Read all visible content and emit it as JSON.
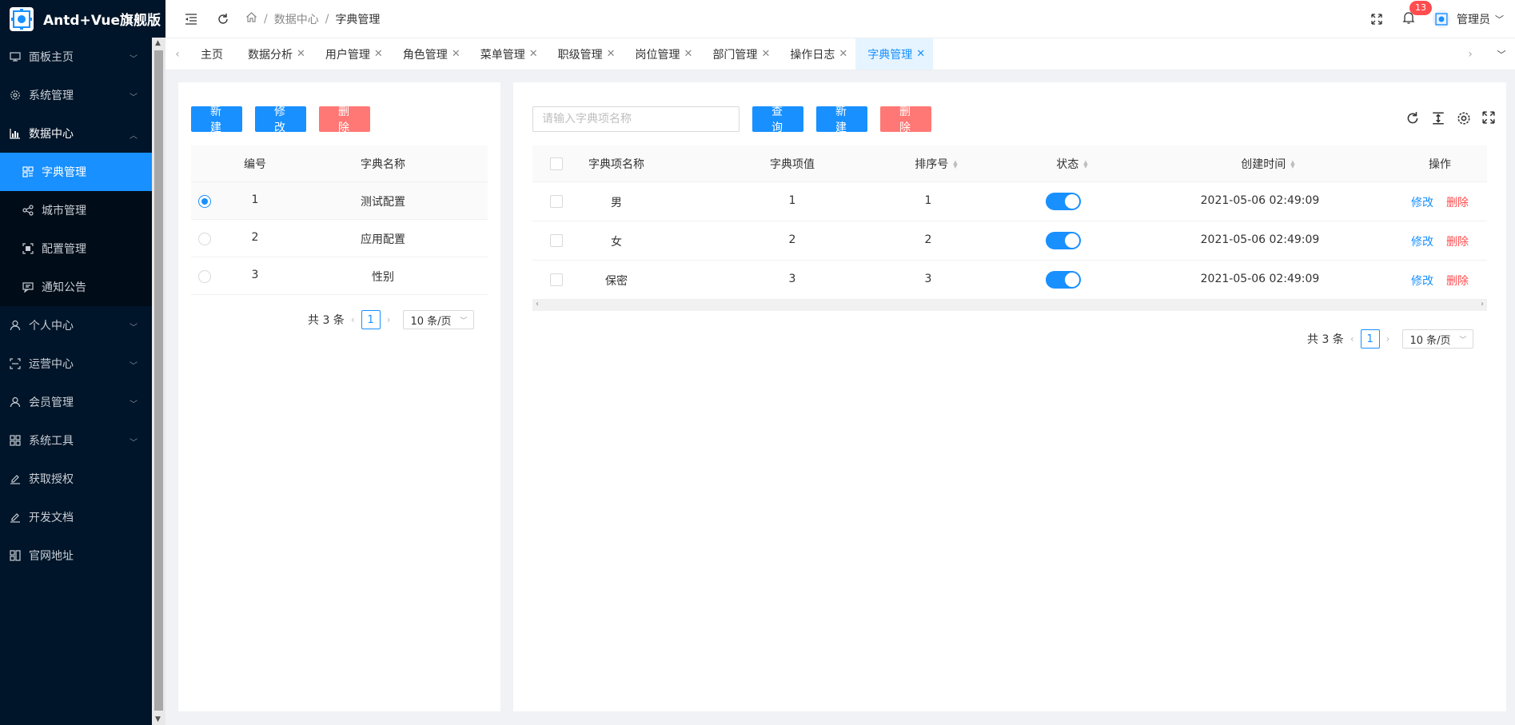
{
  "app": {
    "title": "Antd+Vue旗舰版"
  },
  "sidebar": {
    "items": [
      {
        "label": "面板主页",
        "icon": "monitor-icon"
      },
      {
        "label": "系统管理",
        "icon": "gear-icon"
      },
      {
        "label": "数据中心",
        "icon": "chart-icon",
        "open": true,
        "children": [
          {
            "label": "字典管理",
            "icon": "dictionary-icon",
            "active": true
          },
          {
            "label": "城市管理",
            "icon": "share-icon"
          },
          {
            "label": "配置管理",
            "icon": "scan-icon"
          },
          {
            "label": "通知公告",
            "icon": "message-icon"
          }
        ]
      },
      {
        "label": "个人中心",
        "icon": "user-icon"
      },
      {
        "label": "运营中心",
        "icon": "scan-icon"
      },
      {
        "label": "会员管理",
        "icon": "user-icon"
      },
      {
        "label": "系统工具",
        "icon": "appstore-icon"
      },
      {
        "label": "获取授权",
        "icon": "edit-icon"
      },
      {
        "label": "开发文档",
        "icon": "edit-icon"
      },
      {
        "label": "官网地址",
        "icon": "appstore-icon"
      }
    ]
  },
  "header": {
    "breadcrumb": [
      "数据中心",
      "字典管理"
    ],
    "notification_count": "13",
    "user_name": "管理员"
  },
  "tabs": [
    {
      "label": "主页",
      "closable": false
    },
    {
      "label": "数据分析",
      "closable": true
    },
    {
      "label": "用户管理",
      "closable": true
    },
    {
      "label": "角色管理",
      "closable": true
    },
    {
      "label": "菜单管理",
      "closable": true
    },
    {
      "label": "职级管理",
      "closable": true
    },
    {
      "label": "岗位管理",
      "closable": true
    },
    {
      "label": "部门管理",
      "closable": true
    },
    {
      "label": "操作日志",
      "closable": true
    },
    {
      "label": "字典管理",
      "closable": true,
      "active": true
    }
  ],
  "left_panel": {
    "buttons": {
      "new": "新 建",
      "edit": "修 改",
      "delete": "删 除"
    },
    "columns": [
      "编号",
      "字典名称"
    ],
    "rows": [
      {
        "id": "1",
        "name": "测试配置",
        "selected": true
      },
      {
        "id": "2",
        "name": "应用配置",
        "selected": false
      },
      {
        "id": "3",
        "name": "性别",
        "selected": false
      }
    ],
    "pagination": {
      "total": "共 3 条",
      "page": "1",
      "page_size": "10 条/页"
    }
  },
  "right_panel": {
    "search_placeholder": "请输入字典项名称",
    "buttons": {
      "query": "查 询",
      "new": "新 建",
      "delete": "删 除"
    },
    "columns": [
      "字典项名称",
      "字典项值",
      "排序号",
      "状态",
      "创建时间",
      "操作"
    ],
    "rows": [
      {
        "name": "男",
        "value": "1",
        "sort": "1",
        "status": true,
        "created": "2021-05-06 02:49:09"
      },
      {
        "name": "女",
        "value": "2",
        "sort": "2",
        "status": true,
        "created": "2021-05-06 02:49:09"
      },
      {
        "name": "保密",
        "value": "3",
        "sort": "3",
        "status": true,
        "created": "2021-05-06 02:49:09"
      }
    ],
    "actions": {
      "edit": "修改",
      "delete": "删除"
    },
    "pagination": {
      "total": "共 3 条",
      "page": "1",
      "page_size": "10 条/页"
    }
  },
  "colors": {
    "primary": "#1890ff",
    "danger": "#ff7875",
    "sidebar_bg": "#001529",
    "submenu_bg": "#000c17"
  }
}
